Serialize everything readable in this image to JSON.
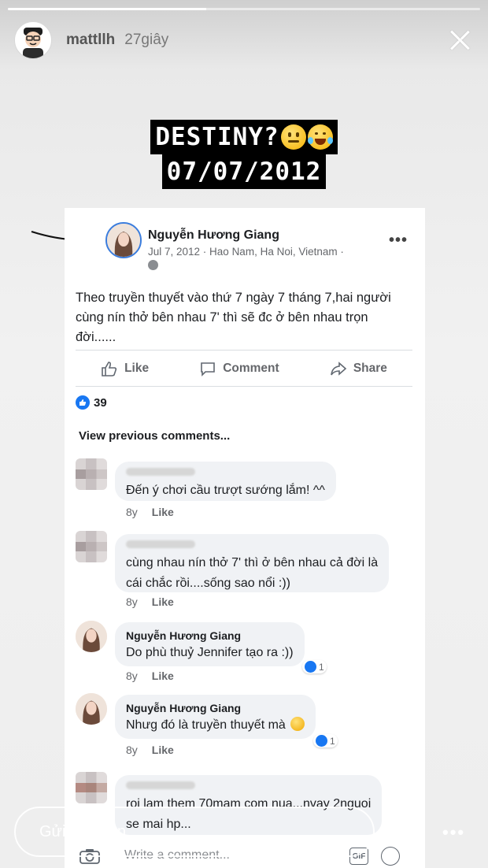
{
  "story": {
    "progress": 0.42,
    "username": "mattllh",
    "timestamp": "27giây",
    "caption_line1": "DESTINY?",
    "caption_emojis": [
      "thinking-face-emoji",
      "laughing-tears-emoji"
    ],
    "caption_line2": "07/07/2012",
    "reply_placeholder": "Gửi tin nhắn",
    "icons": [
      "close-icon",
      "send-icon",
      "more-icon"
    ]
  },
  "post": {
    "author": "Nguyễn Hương Giang",
    "meta": "Jul 7, 2012 · Hao Nam, Ha Noi, Vietnam ·",
    "more": "•••",
    "body": "Theo truyền thuyết vào thứ 7 ngày 7 tháng 7,hai người cùng nín thở bên nhau 7' thì sẽ đc ở bên nhau trọn đời......",
    "actions": {
      "like": "Like",
      "comment": "Comment",
      "share": "Share"
    },
    "reaction_count": "39",
    "view_previous": "View previous comments...",
    "write_placeholder": "Write a comment...",
    "gif_label": "GIF",
    "comments": [
      {
        "name": "",
        "text": "Đến ý chơi cầu trượt sướng lắm! ^^",
        "age": "8y",
        "like": "Like"
      },
      {
        "name": "",
        "text_line1": "cùng nhau nín thở 7' thì ở bên nhau cả đời là",
        "text_line2": "cái chắc rồi....sống sao nổi :))",
        "age": "8y",
        "like": "Like"
      },
      {
        "name": "Nguyễn Hương Giang",
        "text": "Do phù thuỷ Jennifer tạo ra :))",
        "age": "8y",
        "like": "Like",
        "likes": "1"
      },
      {
        "name": "Nguyễn Hương Giang",
        "text": "Nhưg đó là truyền thuyết mà",
        "age": "8y",
        "like": "Like",
        "likes": "1"
      },
      {
        "name": "",
        "text_line1": "roi lam them 70mam com  nua...nvay 2nguoi",
        "text_line2": "se mai hp..."
      }
    ]
  },
  "colors": {
    "facebook_blue": "#1877f2",
    "bubble": "#f0f2f5",
    "meta_gray": "#65676b"
  }
}
